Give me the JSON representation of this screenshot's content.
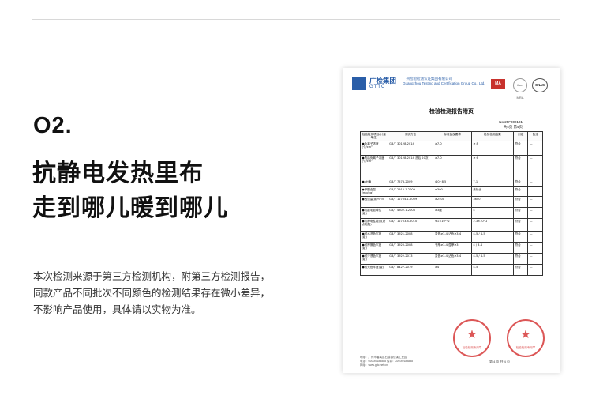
{
  "section": {
    "number": "O2.",
    "headline_line1": "抗静电发热里布",
    "headline_line2": "走到哪儿暖到哪儿",
    "description_lines": [
      "本次检测来源于第三方检测机构，附第三方检测报告，",
      "同款产品不同批次不同颜色的检测结果存在微小差异，",
      "不影响产品使用，具体请以实物为准。"
    ]
  },
  "report": {
    "org_name": "广检集团",
    "org_abbr": "GTTC",
    "institute_lines": [
      "广州检验检测认证集团有限公司",
      "Guangzhou Testing and Certification Group Co., Ltd."
    ],
    "certs": {
      "cma": "MA",
      "ilac": "ilac-MRA",
      "cnas": "CNAS"
    },
    "title": "检验检测报告附页",
    "report_no": "No:25F002101",
    "page_info": "共4页 第4页",
    "table_headers": [
      "检验检测项目(计量单位)",
      "测试方法",
      "标准值及要求",
      "检验检测结果",
      "判定",
      "备注"
    ],
    "rows": [
      [
        "●负离子浓度(个/cm³)",
        "GB/T 30128-2014",
        "≥7.0",
        "≥ 8",
        "符合",
        "—"
      ],
      [
        "●洗后负离子浓度(个/cm³)",
        "GB/T 30128-2014 洗后 20次",
        "≥7.0",
        "≥ 6",
        "符合",
        "—"
      ],
      [
        "●pH值",
        "GB/T 7573-2009",
        "4.0~8.5",
        "7.1",
        "符合",
        "—"
      ],
      [
        "●甲醛含量(mg/kg)",
        "GB/T 2912.1-2009",
        "≤300",
        "未检出",
        "符合",
        "—"
      ],
      [
        "●透湿量(g/m²·d)",
        "GB/T 12704.1-2009",
        "≥2500",
        "3600",
        "符合",
        "—"
      ],
      [
        "●抗起毛起球性(级)",
        "GB/T 4802.1-2008",
        "≥3级",
        "4",
        "符合",
        "—"
      ],
      [
        "●抗静电性能(点对点电阻)",
        "GB/T 12703.4-2010",
        "≤1×10¹¹Ω",
        "2.3×10⁸Ω",
        "符合",
        "—"
      ],
      [
        "●耐水洗色牢度(级)",
        "GB/T 3921-2008",
        "变色≥3-4 沾色≥3-4",
        "4-5 / 4-5",
        "符合",
        "—"
      ],
      [
        "●耐摩擦色牢度(级)",
        "GB/T 3920-2008",
        "干摩≥3-4 湿摩≥3",
        "4 / 3-4",
        "符合",
        "—"
      ],
      [
        "●耐汗渍色牢度(级)",
        "GB/T 3922-2013",
        "变色≥3-4 沾色≥3-4",
        "4-5 / 4-5",
        "符合",
        "—"
      ],
      [
        "●耐光色牢度(级)",
        "GB/T 8427-2019",
        "≥4",
        "4-5",
        "符合",
        "—"
      ]
    ],
    "footer_lines": [
      "地址：广州市番禺区石楼镇岳溪工业园",
      "电话：020-89183888 传真：020-89183888",
      "网址：www.gttc.net.cn"
    ],
    "page_footer": "第 4 页 共 4 页",
    "seal_text": "检验检测专用章"
  },
  "colors": {
    "brand_blue": "#2a5ea8",
    "seal_red": "#d63a3a",
    "cma_red": "#c8322d"
  }
}
